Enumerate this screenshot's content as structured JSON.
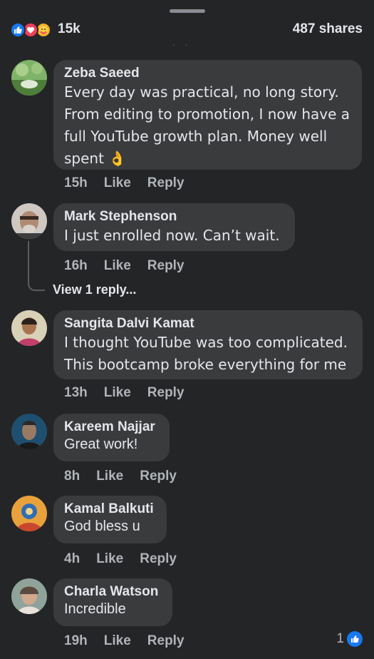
{
  "post": {
    "reaction_count": "15k",
    "shares": "487 shares",
    "reaction_icons": [
      "like-icon",
      "love-icon",
      "care-icon"
    ]
  },
  "comments": [
    {
      "author": "Zeba Saeed",
      "text": "Every day was practical, no long story. From editing to promotion, I now have a full YouTube growth plan. Money well spent 👌",
      "time": "15h",
      "like": "Like",
      "reply": "Reply"
    },
    {
      "author": "Mark Stephenson",
      "text": "I just enrolled now. Can’t wait.",
      "time": "16h",
      "like": "Like",
      "reply": "Reply",
      "view_replies": "View 1 reply..."
    },
    {
      "author": "Sangita Dalvi Kamat",
      "text": "I thought YouTube was too complicated. This bootcamp broke everything for me",
      "time": "13h",
      "like": "Like",
      "reply": "Reply"
    },
    {
      "author": "Kareem Najjar",
      "text": "Great work!",
      "time": "8h",
      "like": "Like",
      "reply": "Reply"
    },
    {
      "author": "Kamal Balkuti",
      "text": "God bless u",
      "time": "4h",
      "like": "Like",
      "reply": "Reply"
    },
    {
      "author": "Charla Watson",
      "text": "Incredible",
      "time": "19h",
      "like": "Like",
      "reply": "Reply",
      "like_count": "1"
    }
  ],
  "colors": {
    "background": "#242526",
    "bubble": "#3a3b3c",
    "accent": "#1877f2",
    "muted": "#b0b3b8"
  }
}
